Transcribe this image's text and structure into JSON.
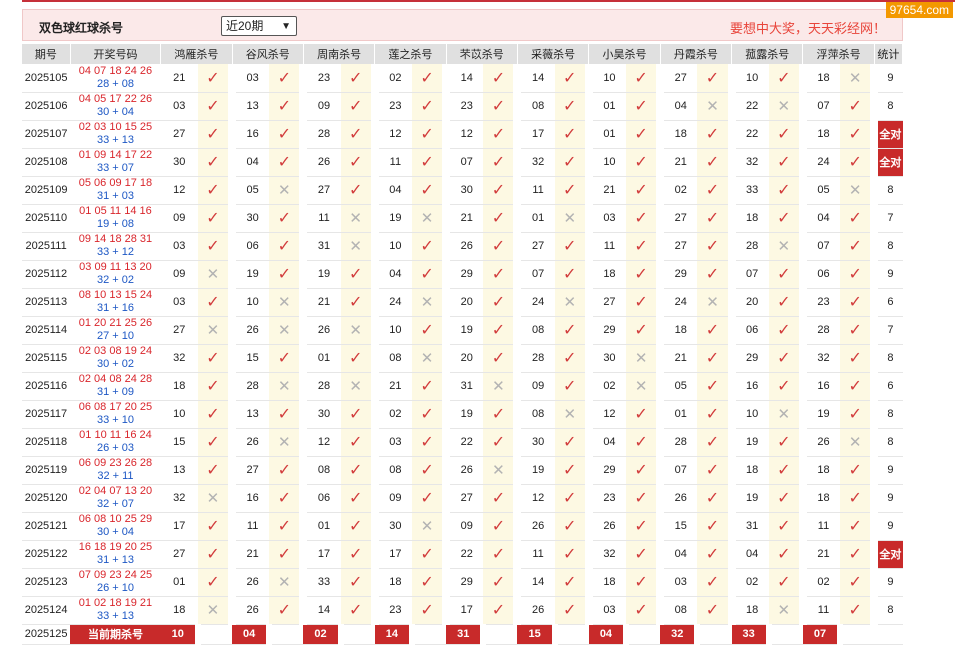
{
  "watermark": "97654.com",
  "header": {
    "title": "双色球红球杀号",
    "select_value": "近20期",
    "slogan": "要想中大奖，天天彩经网！"
  },
  "columns": [
    "期号",
    "开奖号码",
    "鸿雁杀号",
    "谷风杀号",
    "周南杀号",
    "莲之杀号",
    "芣苡杀号",
    "采薇杀号",
    "小昊杀号",
    "丹霞杀号",
    "菰露杀号",
    "浮萍杀号",
    "统计"
  ],
  "rows": [
    {
      "issue": "2025105",
      "reds": "04 07 18 24 26",
      "blues": "28 + 08",
      "kills": [
        [
          "21",
          1
        ],
        [
          "03",
          1
        ],
        [
          "23",
          1
        ],
        [
          "02",
          1
        ],
        [
          "14",
          1
        ],
        [
          "14",
          1
        ],
        [
          "10",
          1
        ],
        [
          "27",
          1
        ],
        [
          "10",
          1
        ],
        [
          "18",
          0
        ]
      ],
      "stat": "9"
    },
    {
      "issue": "2025106",
      "reds": "04 05 17 22 26",
      "blues": "30 + 04",
      "kills": [
        [
          "03",
          1
        ],
        [
          "13",
          1
        ],
        [
          "09",
          1
        ],
        [
          "23",
          1
        ],
        [
          "23",
          1
        ],
        [
          "08",
          1
        ],
        [
          "01",
          1
        ],
        [
          "04",
          0
        ],
        [
          "22",
          0
        ],
        [
          "07",
          1
        ]
      ],
      "stat": "8"
    },
    {
      "issue": "2025107",
      "reds": "02 03 10 15 25",
      "blues": "33 + 13",
      "kills": [
        [
          "27",
          1
        ],
        [
          "16",
          1
        ],
        [
          "28",
          1
        ],
        [
          "12",
          1
        ],
        [
          "12",
          1
        ],
        [
          "17",
          1
        ],
        [
          "01",
          1
        ],
        [
          "18",
          1
        ],
        [
          "22",
          1
        ],
        [
          "18",
          1
        ]
      ],
      "stat": "全对"
    },
    {
      "issue": "2025108",
      "reds": "01 09 14 17 22",
      "blues": "33 + 07",
      "kills": [
        [
          "30",
          1
        ],
        [
          "04",
          1
        ],
        [
          "26",
          1
        ],
        [
          "11",
          1
        ],
        [
          "07",
          1
        ],
        [
          "32",
          1
        ],
        [
          "10",
          1
        ],
        [
          "21",
          1
        ],
        [
          "32",
          1
        ],
        [
          "24",
          1
        ]
      ],
      "stat": "全对"
    },
    {
      "issue": "2025109",
      "reds": "05 06 09 17 18",
      "blues": "31 + 03",
      "kills": [
        [
          "12",
          1
        ],
        [
          "05",
          0
        ],
        [
          "27",
          1
        ],
        [
          "04",
          1
        ],
        [
          "30",
          1
        ],
        [
          "11",
          1
        ],
        [
          "21",
          1
        ],
        [
          "02",
          1
        ],
        [
          "33",
          1
        ],
        [
          "05",
          0
        ]
      ],
      "stat": "8"
    },
    {
      "issue": "2025110",
      "reds": "01 05 11 14 16",
      "blues": "19 + 08",
      "kills": [
        [
          "09",
          1
        ],
        [
          "30",
          1
        ],
        [
          "11",
          0
        ],
        [
          "19",
          0
        ],
        [
          "21",
          1
        ],
        [
          "01",
          0
        ],
        [
          "03",
          1
        ],
        [
          "27",
          1
        ],
        [
          "18",
          1
        ],
        [
          "04",
          1
        ]
      ],
      "stat": "7"
    },
    {
      "issue": "2025111",
      "reds": "09 14 18 28 31",
      "blues": "33 + 12",
      "kills": [
        [
          "03",
          1
        ],
        [
          "06",
          1
        ],
        [
          "31",
          0
        ],
        [
          "10",
          1
        ],
        [
          "26",
          1
        ],
        [
          "27",
          1
        ],
        [
          "11",
          1
        ],
        [
          "27",
          1
        ],
        [
          "28",
          0
        ],
        [
          "07",
          1
        ]
      ],
      "stat": "8"
    },
    {
      "issue": "2025112",
      "reds": "03 09 11 13 20",
      "blues": "32 + 02",
      "kills": [
        [
          "09",
          0
        ],
        [
          "19",
          1
        ],
        [
          "19",
          1
        ],
        [
          "04",
          1
        ],
        [
          "29",
          1
        ],
        [
          "07",
          1
        ],
        [
          "18",
          1
        ],
        [
          "29",
          1
        ],
        [
          "07",
          1
        ],
        [
          "06",
          1
        ]
      ],
      "stat": "9"
    },
    {
      "issue": "2025113",
      "reds": "08 10 13 15 24",
      "blues": "31 + 16",
      "kills": [
        [
          "03",
          1
        ],
        [
          "10",
          0
        ],
        [
          "21",
          1
        ],
        [
          "24",
          0
        ],
        [
          "20",
          1
        ],
        [
          "24",
          0
        ],
        [
          "27",
          1
        ],
        [
          "24",
          0
        ],
        [
          "20",
          1
        ],
        [
          "23",
          1
        ]
      ],
      "stat": "6"
    },
    {
      "issue": "2025114",
      "reds": "01 20 21 25 26",
      "blues": "27 + 10",
      "kills": [
        [
          "27",
          0
        ],
        [
          "26",
          0
        ],
        [
          "26",
          0
        ],
        [
          "10",
          1
        ],
        [
          "19",
          1
        ],
        [
          "08",
          1
        ],
        [
          "29",
          1
        ],
        [
          "18",
          1
        ],
        [
          "06",
          1
        ],
        [
          "28",
          1
        ]
      ],
      "stat": "7"
    },
    {
      "issue": "2025115",
      "reds": "02 03 08 19 24",
      "blues": "30 + 02",
      "kills": [
        [
          "32",
          1
        ],
        [
          "15",
          1
        ],
        [
          "01",
          1
        ],
        [
          "08",
          0
        ],
        [
          "20",
          1
        ],
        [
          "28",
          1
        ],
        [
          "30",
          0
        ],
        [
          "21",
          1
        ],
        [
          "29",
          1
        ],
        [
          "32",
          1
        ]
      ],
      "stat": "8"
    },
    {
      "issue": "2025116",
      "reds": "02 04 08 24 28",
      "blues": "31 + 09",
      "kills": [
        [
          "18",
          1
        ],
        [
          "28",
          0
        ],
        [
          "28",
          0
        ],
        [
          "21",
          1
        ],
        [
          "31",
          0
        ],
        [
          "09",
          1
        ],
        [
          "02",
          0
        ],
        [
          "05",
          1
        ],
        [
          "16",
          1
        ],
        [
          "16",
          1
        ]
      ],
      "stat": "6"
    },
    {
      "issue": "2025117",
      "reds": "06 08 17 20 25",
      "blues": "33 + 10",
      "kills": [
        [
          "10",
          1
        ],
        [
          "13",
          1
        ],
        [
          "30",
          1
        ],
        [
          "02",
          1
        ],
        [
          "19",
          1
        ],
        [
          "08",
          0
        ],
        [
          "12",
          1
        ],
        [
          "01",
          1
        ],
        [
          "10",
          0
        ],
        [
          "19",
          1
        ]
      ],
      "stat": "8"
    },
    {
      "issue": "2025118",
      "reds": "01 10 11 16 24",
      "blues": "26 + 03",
      "kills": [
        [
          "15",
          1
        ],
        [
          "26",
          0
        ],
        [
          "12",
          1
        ],
        [
          "03",
          1
        ],
        [
          "22",
          1
        ],
        [
          "30",
          1
        ],
        [
          "04",
          1
        ],
        [
          "28",
          1
        ],
        [
          "19",
          1
        ],
        [
          "26",
          0
        ]
      ],
      "stat": "8"
    },
    {
      "issue": "2025119",
      "reds": "06 09 23 26 28",
      "blues": "32 + 11",
      "kills": [
        [
          "13",
          1
        ],
        [
          "27",
          1
        ],
        [
          "08",
          1
        ],
        [
          "08",
          1
        ],
        [
          "26",
          0
        ],
        [
          "19",
          1
        ],
        [
          "29",
          1
        ],
        [
          "07",
          1
        ],
        [
          "18",
          1
        ],
        [
          "18",
          1
        ]
      ],
      "stat": "9"
    },
    {
      "issue": "2025120",
      "reds": "02 04 07 13 20",
      "blues": "32 + 07",
      "kills": [
        [
          "32",
          0
        ],
        [
          "16",
          1
        ],
        [
          "06",
          1
        ],
        [
          "09",
          1
        ],
        [
          "27",
          1
        ],
        [
          "12",
          1
        ],
        [
          "23",
          1
        ],
        [
          "26",
          1
        ],
        [
          "19",
          1
        ],
        [
          "18",
          1
        ]
      ],
      "stat": "9"
    },
    {
      "issue": "2025121",
      "reds": "06 08 10 25 29",
      "blues": "30 + 04",
      "kills": [
        [
          "17",
          1
        ],
        [
          "11",
          1
        ],
        [
          "01",
          1
        ],
        [
          "30",
          0
        ],
        [
          "09",
          1
        ],
        [
          "26",
          1
        ],
        [
          "26",
          1
        ],
        [
          "15",
          1
        ],
        [
          "31",
          1
        ],
        [
          "11",
          1
        ]
      ],
      "stat": "9"
    },
    {
      "issue": "2025122",
      "reds": "16 18 19 20 25",
      "blues": "31 + 13",
      "kills": [
        [
          "27",
          1
        ],
        [
          "21",
          1
        ],
        [
          "17",
          1
        ],
        [
          "17",
          1
        ],
        [
          "22",
          1
        ],
        [
          "11",
          1
        ],
        [
          "32",
          1
        ],
        [
          "04",
          1
        ],
        [
          "04",
          1
        ],
        [
          "21",
          1
        ]
      ],
      "stat": "全对"
    },
    {
      "issue": "2025123",
      "reds": "07 09 23 24 25",
      "blues": "26 + 10",
      "kills": [
        [
          "01",
          1
        ],
        [
          "26",
          0
        ],
        [
          "33",
          1
        ],
        [
          "18",
          1
        ],
        [
          "29",
          1
        ],
        [
          "14",
          1
        ],
        [
          "18",
          1
        ],
        [
          "03",
          1
        ],
        [
          "02",
          1
        ],
        [
          "02",
          1
        ]
      ],
      "stat": "9"
    },
    {
      "issue": "2025124",
      "reds": "01 02 18 19 21",
      "blues": "33 + 13",
      "kills": [
        [
          "18",
          0
        ],
        [
          "26",
          1
        ],
        [
          "14",
          1
        ],
        [
          "23",
          1
        ],
        [
          "17",
          1
        ],
        [
          "26",
          1
        ],
        [
          "03",
          1
        ],
        [
          "08",
          1
        ],
        [
          "18",
          0
        ],
        [
          "11",
          1
        ]
      ],
      "stat": "8"
    }
  ],
  "current": {
    "issue": "2025125",
    "label": "当前期杀号",
    "kills": [
      "10",
      "04",
      "02",
      "14",
      "31",
      "15",
      "04",
      "32",
      "33",
      "07"
    ]
  },
  "colors": {
    "accent_red": "#c82a2a",
    "mark_bg": "#fdf9e3",
    "blue_ball": "#1d57c4",
    "red_ball": "#d9262c"
  },
  "icons": {
    "hit": "check-icon",
    "miss": "cross-icon"
  }
}
